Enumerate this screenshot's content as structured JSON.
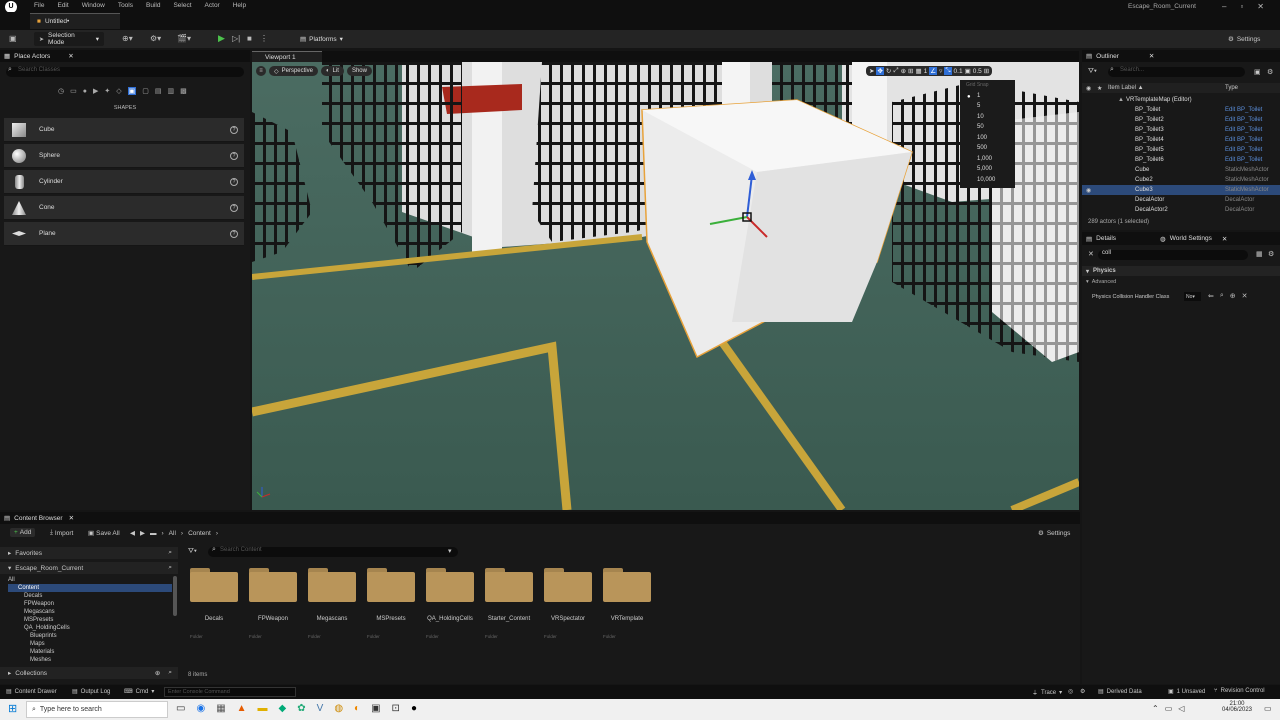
{
  "menubar": {
    "logo": "U",
    "items": [
      "File",
      "Edit",
      "Window",
      "Tools",
      "Build",
      "Select",
      "Actor",
      "Help"
    ],
    "project_name": "Escape_Room_Current",
    "doc_tab": "Untitled•"
  },
  "toolbar": {
    "selection_mode": "Selection Mode",
    "platforms": "Platforms",
    "settings": "Settings"
  },
  "place_actors": {
    "tab": "Place Actors",
    "search_placeholder": "Search Classes",
    "section": "SHAPES",
    "items": [
      "Cube",
      "Sphere",
      "Cylinder",
      "Cone",
      "Plane"
    ]
  },
  "viewport": {
    "tab": "Viewport 1",
    "perspective": "Perspective",
    "lit": "Lit",
    "show": "Show",
    "snap_title": "Grid Snap",
    "snap_values": [
      "1",
      "5",
      "10",
      "50",
      "100",
      "500",
      "1,000",
      "5,000",
      "10,000"
    ],
    "snap_right_value": "0.1",
    "snap_scale_value": "0.5"
  },
  "outliner": {
    "tab": "Outliner",
    "search_placeholder": "Search...",
    "col_label": "Item Label ▲",
    "col_type": "Type",
    "root": "VRTemplateMap (Editor)",
    "rows": [
      {
        "name": "BP_Toilet",
        "type": "Edit BP_Toilet"
      },
      {
        "name": "BP_Toilet2",
        "type": "Edit BP_Toilet"
      },
      {
        "name": "BP_Toilet3",
        "type": "Edit BP_Toilet"
      },
      {
        "name": "BP_Toilet4",
        "type": "Edit BP_Toilet"
      },
      {
        "name": "BP_Toilet5",
        "type": "Edit BP_Toilet"
      },
      {
        "name": "BP_Toilet6",
        "type": "Edit BP_Toilet"
      },
      {
        "name": "Cube",
        "type": "StaticMeshActor"
      },
      {
        "name": "Cube2",
        "type": "StaticMeshActor"
      },
      {
        "name": "Cube3",
        "type": "StaticMeshActor"
      },
      {
        "name": "DecalActor",
        "type": "DecalActor"
      },
      {
        "name": "DecalActor2",
        "type": "DecalActor"
      }
    ],
    "footer": "289 actors (1 selected)"
  },
  "details": {
    "tab": "Details",
    "world_settings_tab": "World Settings",
    "search_value": "coll",
    "category": "Physics",
    "subcategory": "Advanced",
    "property_label": "Physics Collision Handler Class",
    "property_value": "No"
  },
  "content_browser": {
    "tab": "Content Browser",
    "add": "Add",
    "import": "Import",
    "save_all": "Save All",
    "path_all": "All",
    "path_content": "Content",
    "settings": "Settings",
    "favorites": "Favorites",
    "project": "Escape_Room_Current",
    "search_placeholder": "Search Content",
    "tree": [
      "All",
      "Content",
      "Decals",
      "FPWeapon",
      "Megascans",
      "MSPresets",
      "QA_HoldingCells",
      "Blueprints",
      "Maps",
      "Materials",
      "Meshes"
    ],
    "folders": [
      "Decals",
      "FPWeapon",
      "Megascans",
      "MSPresets",
      "QA_HoldingCells",
      "Starter_Content",
      "VRSpectator",
      "VRTemplate"
    ],
    "folder_kind": "Folder",
    "item_count": "8 items",
    "collections": "Collections"
  },
  "statusbar": {
    "content_drawer": "Content Drawer",
    "output_log": "Output Log",
    "cmd": "Cmd",
    "console_placeholder": "Enter Console Command",
    "trace": "Trace",
    "derived_data": "Derived Data",
    "unsaved": "1 Unsaved",
    "revision": "Revision Control"
  },
  "taskbar": {
    "search_placeholder": "Type here to search",
    "time": "21:00",
    "date": "04/06/2023"
  },
  "colors": {
    "accent": "#2f6fd6",
    "selection": "#e8a23a",
    "folder": "#b9955a"
  }
}
